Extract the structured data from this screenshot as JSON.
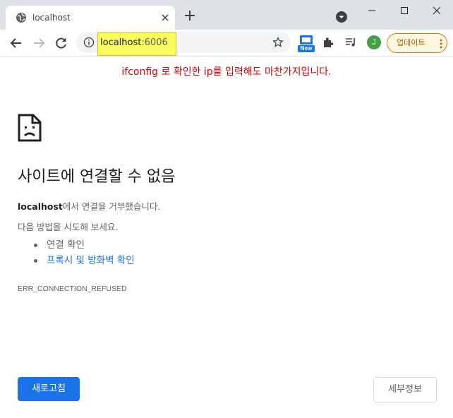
{
  "tab": {
    "title": "localhost",
    "icon": "globe-icon"
  },
  "toolbar": {
    "url_host": "localhost",
    "url_port": ":6006",
    "new_badge": "New",
    "avatar_initial": "J",
    "update_label": "업데이트"
  },
  "annotation": "ifconfig 로 확인한 ip를 입력해도 마찬가지입니다.",
  "error": {
    "heading": "사이트에 연결할 수 없음",
    "host": "localhost",
    "refused_text": "에서 연결을 거부했습니다.",
    "try_text": "다음 방법을 시도해 보세요.",
    "suggestions": [
      "연결 확인",
      "프록시 및 방화벽 확인"
    ],
    "code": "ERR_CONNECTION_REFUSED"
  },
  "buttons": {
    "reload": "새로고침",
    "details": "세부정보"
  },
  "colors": {
    "accent": "#1a73e8",
    "annotation": "#d50000",
    "highlight": "#fbfb5e",
    "update": "#e8710a"
  }
}
